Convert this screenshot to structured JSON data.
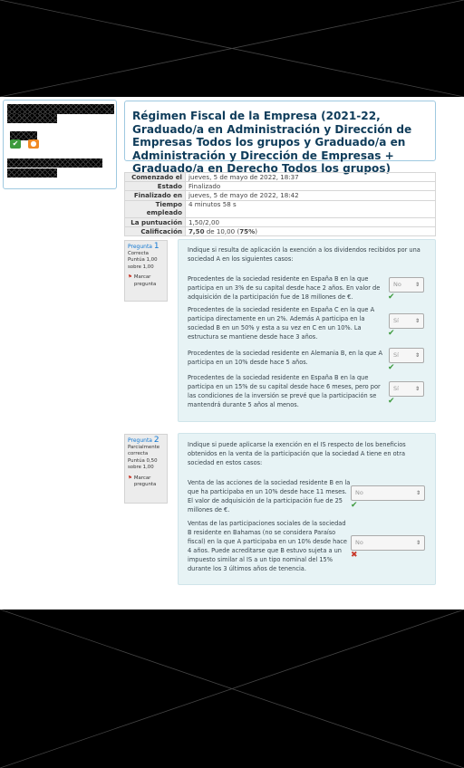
{
  "course": {
    "title": "Régimen Fiscal de la Empresa (2021-22, Graduado/a en Administración y Dirección de Empresas Todos los grupos y Graduado/a en Administración y Dirección de Empresas + Graduado/a en Derecho Todos los grupos)"
  },
  "summary": [
    {
      "label": "Comenzado el",
      "value": "jueves, 5 de mayo de 2022, 18:37"
    },
    {
      "label": "Estado",
      "value": "Finalizado"
    },
    {
      "label": "Finalizado en",
      "value": "jueves, 5 de mayo de 2022, 18:42"
    },
    {
      "label": "Tiempo empleado",
      "value": "4 minutos 58 s"
    },
    {
      "label": "La puntuación",
      "value": "1,50/2,00"
    },
    {
      "label": "Calificación",
      "value_bold": "7,50",
      "value_rest": " de 10,00 (",
      "value_pct": "75%",
      "value_end": ")"
    }
  ],
  "q1": {
    "label": "Pregunta",
    "number": "1",
    "status": "Correcta",
    "score": "Puntúa 1,00 sobre 1,00",
    "flag": "Marcar pregunta",
    "intro": "Indique si resulta de aplicación la exención a los dividendos recibidos por una sociedad A en los siguientes casos:",
    "items": [
      {
        "text": "Procedentes de la sociedad residente en España B en la que participa en un 3% de su capital desde hace 2 años.  En valor de adquisición de la participación fue de 18 millones de €.",
        "answer": "No",
        "result": "correct"
      },
      {
        "text": "Procedentes de la sociedad residente en España C en la que A participa directamente en un 2%.  Además A participa en la sociedad B en un 50% y esta a su vez en C en un 10%.  La estructura se mantiene desde hace 3 años.",
        "answer": "Sí",
        "result": "correct"
      },
      {
        "text": "Procedentes de  la sociedad residente en Alemania B, en la que A participa en un 10% desde hace 5 años.",
        "answer": "Sí",
        "result": "correct"
      },
      {
        "text": "Procedentes de la sociedad residente en España B en la que participa en un 15% de su capital desde hace 6 meses, pero por las condiciones de la inversión se prevé que la participación se mantendrá durante 5 años al menos.",
        "answer": "Sí",
        "result": "correct"
      }
    ]
  },
  "q2": {
    "label": "Pregunta",
    "number": "2",
    "status": "Parcialmente correcta",
    "score": "Puntúa 0,50 sobre 1,00",
    "flag": "Marcar pregunta",
    "intro": "Indique si puede aplicarse la exención en el IS respecto de los beneficios obtenidos en la venta de la participación que la sociedad A tiene en otra sociedad en estos casos:",
    "items": [
      {
        "text": "Venta de las acciones de la sociedad residente B en la que ha participaba en un 10% desde hace 11 meses.  El valor de adquisición de la participación fue de 25 millones de €.",
        "answer": "No",
        "result": "correct"
      },
      {
        "text": "Ventas de las participaciones sociales de la sociedad B residente en Bahamas (no se considera Paraíso fiscal) en la que A participaba en un 10% desde hace 4 años.  Puede acreditarse que B estuvo sujeta a un impuesto similar al IS a un tipo nominal del 15% durante los 3 últimos años de tenencia.",
        "answer": "No",
        "result": "incorrect"
      }
    ]
  },
  "icons": {
    "select_arrow": "⇕",
    "correct": "✔",
    "incorrect": "✖",
    "flag": "flag-icon"
  },
  "colors": {
    "accent": "#1177d1",
    "correct": "#3d9a3d",
    "incorrect": "#c8382a",
    "panel": "#e7f3f5",
    "info": "#ececec"
  }
}
